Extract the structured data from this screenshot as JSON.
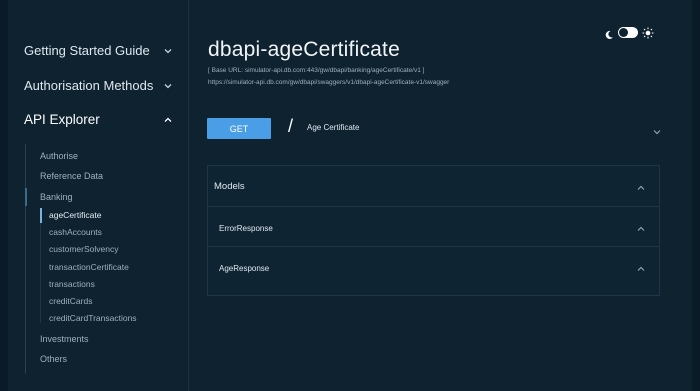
{
  "sidebar": {
    "top_items": [
      {
        "label": "Getting Started Guide",
        "expanded": false
      },
      {
        "label": "Authorisation Methods",
        "expanded": false
      },
      {
        "label": "API Explorer",
        "expanded": true
      }
    ],
    "sub_items": [
      "Authorise",
      "Reference Data",
      "Banking",
      "Investments",
      "Others"
    ],
    "banking_items": [
      "ageCertificate",
      "cashAccounts",
      "customerSolvency",
      "transactionCertificate",
      "transactions",
      "creditCards",
      "creditCardTransactions"
    ],
    "active_item": "ageCertificate"
  },
  "main": {
    "title": "dbapi-ageCertificate",
    "base_url": "[ Base URL: simulator-api.db.com:443/gw/dbapi/banking/ageCertificate/v1 ]",
    "swagger_url": "https://simulator-api.db.com/gw/dbapi/swaggers/v1/dbapi-ageCertificate-v1/swagger",
    "method": "GET",
    "slash": "/",
    "endpoint_label": "Age Certificate",
    "models": {
      "title": "Models",
      "items": [
        "ErrorResponse",
        "AgeResponse"
      ]
    }
  },
  "theme_toggle": {
    "mode": "dark"
  },
  "colors": {
    "background": "#0e2230",
    "accent": "#4a9ee6",
    "text": "#dfe7ee",
    "muted": "#9fb0bd"
  }
}
